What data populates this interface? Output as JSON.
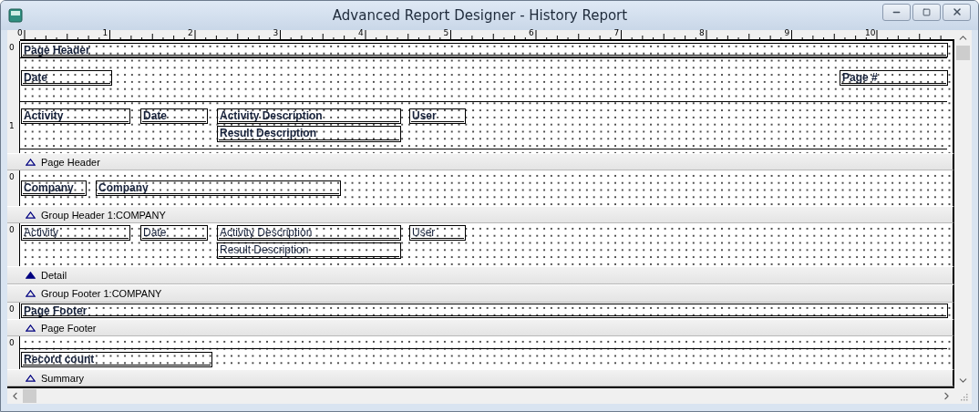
{
  "window": {
    "title": "Advanced Report Designer - History Report"
  },
  "ruler": [
    "0",
    "1",
    "2",
    "3",
    "4",
    "5",
    "6",
    "7",
    "8",
    "9",
    "10"
  ],
  "sections": [
    {
      "label": "Page Header",
      "selected": false,
      "ruler_marks": [
        "0",
        "1"
      ],
      "fields": [
        {
          "text": "Page Header",
          "bold": true
        },
        {
          "text": "Date",
          "bold": true
        },
        {
          "text": "Page #",
          "bold": true
        },
        {
          "text": "Activity",
          "bold": true
        },
        {
          "text": "Date",
          "bold": true
        },
        {
          "text": "Activity Description",
          "bold": true
        },
        {
          "text": "User",
          "bold": true
        },
        {
          "text": "Result Description",
          "bold": true
        }
      ]
    },
    {
      "label": "Group Header 1:COMPANY",
      "selected": false,
      "ruler_marks": [
        "0"
      ],
      "fields": [
        {
          "text": "Company",
          "bold": true
        },
        {
          "text": "Company",
          "bold": true
        }
      ]
    },
    {
      "label": "Detail",
      "selected": true,
      "ruler_marks": [
        "0"
      ],
      "fields": [
        {
          "text": "Activity",
          "bold": false
        },
        {
          "text": "Date",
          "bold": false
        },
        {
          "text": "Activity Description",
          "bold": false
        },
        {
          "text": "User",
          "bold": false
        },
        {
          "text": "Result Description",
          "bold": false
        }
      ]
    },
    {
      "label": "Group Footer 1:COMPANY",
      "selected": false
    },
    {
      "label": "Page Footer",
      "selected": false,
      "ruler_marks": [
        "0"
      ],
      "fields": [
        {
          "text": "Page Footer",
          "bold": true
        }
      ]
    },
    {
      "label": "Summary",
      "selected": false,
      "ruler_marks": [
        "0"
      ],
      "fields": [
        {
          "text": "Record count",
          "bold": true
        }
      ]
    }
  ]
}
